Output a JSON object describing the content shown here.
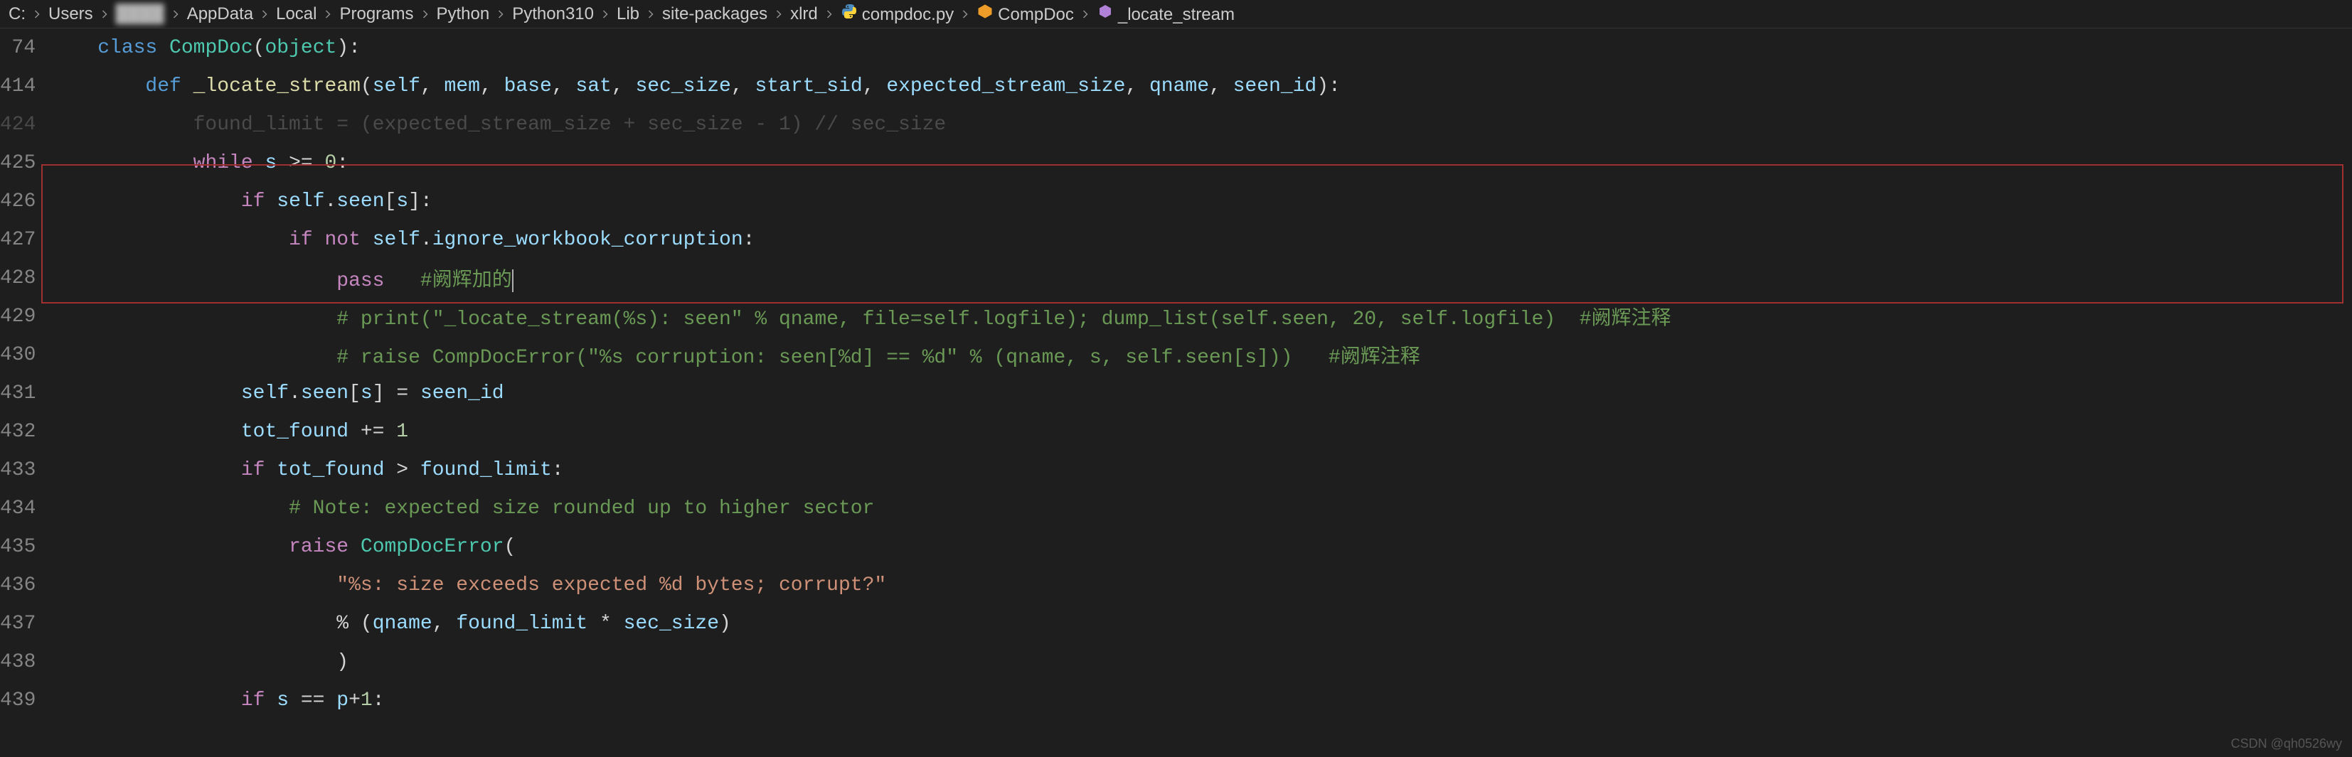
{
  "breadcrumb": {
    "items": [
      {
        "label": "C:",
        "icon": null
      },
      {
        "label": "Users",
        "icon": null
      },
      {
        "label": "████",
        "icon": null,
        "blurred": true
      },
      {
        "label": "AppData",
        "icon": null
      },
      {
        "label": "Local",
        "icon": null
      },
      {
        "label": "Programs",
        "icon": null
      },
      {
        "label": "Python",
        "icon": null
      },
      {
        "label": "Python310",
        "icon": null
      },
      {
        "label": "Lib",
        "icon": null
      },
      {
        "label": "site-packages",
        "icon": null
      },
      {
        "label": "xlrd",
        "icon": null
      },
      {
        "label": "compdoc.py",
        "icon": "python"
      },
      {
        "label": "CompDoc",
        "icon": "class"
      },
      {
        "label": "_locate_stream",
        "icon": "method"
      }
    ]
  },
  "lines": [
    {
      "num": "74",
      "kind": "sticky",
      "tokens": [
        {
          "t": "    ",
          "c": ""
        },
        {
          "t": "class",
          "c": "kw-class"
        },
        {
          "t": " ",
          "c": ""
        },
        {
          "t": "CompDoc",
          "c": "class-name"
        },
        {
          "t": "(",
          "c": "punct"
        },
        {
          "t": "object",
          "c": "builtin"
        },
        {
          "t": "):",
          "c": "punct"
        }
      ]
    },
    {
      "num": "414",
      "kind": "sticky",
      "tokens": [
        {
          "t": "        ",
          "c": ""
        },
        {
          "t": "def",
          "c": "kw-def"
        },
        {
          "t": " ",
          "c": ""
        },
        {
          "t": "_locate_stream",
          "c": "func-name"
        },
        {
          "t": "(",
          "c": "punct"
        },
        {
          "t": "self",
          "c": "param"
        },
        {
          "t": ", ",
          "c": "punct"
        },
        {
          "t": "mem",
          "c": "param"
        },
        {
          "t": ", ",
          "c": "punct"
        },
        {
          "t": "base",
          "c": "param"
        },
        {
          "t": ", ",
          "c": "punct"
        },
        {
          "t": "sat",
          "c": "param"
        },
        {
          "t": ", ",
          "c": "punct"
        },
        {
          "t": "sec_size",
          "c": "param"
        },
        {
          "t": ", ",
          "c": "punct"
        },
        {
          "t": "start_sid",
          "c": "param"
        },
        {
          "t": ", ",
          "c": "punct"
        },
        {
          "t": "expected_stream_size",
          "c": "param"
        },
        {
          "t": ", ",
          "c": "punct"
        },
        {
          "t": "qname",
          "c": "param"
        },
        {
          "t": ", ",
          "c": "punct"
        },
        {
          "t": "seen_id",
          "c": "param"
        },
        {
          "t": "):",
          "c": "punct"
        }
      ]
    },
    {
      "num": "424",
      "kind": "faded",
      "tokens": [
        {
          "t": "            found_limit = (expected_stream_size + sec_size - 1) // sec_size",
          "c": "faded"
        }
      ]
    },
    {
      "num": "425",
      "kind": "normal",
      "tokens": [
        {
          "t": "            ",
          "c": ""
        },
        {
          "t": "while",
          "c": "kw-control"
        },
        {
          "t": " ",
          "c": ""
        },
        {
          "t": "s",
          "c": "prop"
        },
        {
          "t": " >= ",
          "c": "operator"
        },
        {
          "t": "0",
          "c": "number"
        },
        {
          "t": ":",
          "c": "punct"
        }
      ]
    },
    {
      "num": "426",
      "kind": "normal",
      "tokens": [
        {
          "t": "                ",
          "c": ""
        },
        {
          "t": "if",
          "c": "kw-control"
        },
        {
          "t": " ",
          "c": ""
        },
        {
          "t": "self",
          "c": "self-ref"
        },
        {
          "t": ".",
          "c": "punct"
        },
        {
          "t": "seen",
          "c": "prop"
        },
        {
          "t": "[",
          "c": "punct"
        },
        {
          "t": "s",
          "c": "prop"
        },
        {
          "t": "]:",
          "c": "punct"
        }
      ]
    },
    {
      "num": "427",
      "kind": "normal",
      "tokens": [
        {
          "t": "                    ",
          "c": ""
        },
        {
          "t": "if",
          "c": "kw-control"
        },
        {
          "t": " ",
          "c": ""
        },
        {
          "t": "not",
          "c": "kw-control"
        },
        {
          "t": " ",
          "c": ""
        },
        {
          "t": "self",
          "c": "self-ref"
        },
        {
          "t": ".",
          "c": "punct"
        },
        {
          "t": "ignore_workbook_corruption",
          "c": "prop"
        },
        {
          "t": ":",
          "c": "punct"
        }
      ]
    },
    {
      "num": "428",
      "kind": "normal",
      "tokens": [
        {
          "t": "                        ",
          "c": ""
        },
        {
          "t": "pass",
          "c": "kw-control"
        },
        {
          "t": "   ",
          "c": ""
        },
        {
          "t": "#阙辉加的",
          "c": "comment"
        },
        {
          "t": "",
          "c": "cursor"
        }
      ]
    },
    {
      "num": "429",
      "kind": "normal",
      "tokens": [
        {
          "t": "                        ",
          "c": ""
        },
        {
          "t": "# print(\"_locate_stream(%s): seen\" % qname, file=self.logfile); dump_list(self.seen, 20, self.logfile)  #阙辉注释",
          "c": "comment"
        }
      ]
    },
    {
      "num": "430",
      "kind": "normal",
      "tokens": [
        {
          "t": "                        ",
          "c": ""
        },
        {
          "t": "# raise CompDocError(\"%s corruption: seen[%d] == %d\" % (qname, s, self.seen[s]))   #阙辉注释",
          "c": "comment"
        }
      ]
    },
    {
      "num": "431",
      "kind": "normal",
      "tokens": [
        {
          "t": "                ",
          "c": ""
        },
        {
          "t": "self",
          "c": "self-ref"
        },
        {
          "t": ".",
          "c": "punct"
        },
        {
          "t": "seen",
          "c": "prop"
        },
        {
          "t": "[",
          "c": "punct"
        },
        {
          "t": "s",
          "c": "prop"
        },
        {
          "t": "] = ",
          "c": "operator"
        },
        {
          "t": "seen_id",
          "c": "prop"
        }
      ]
    },
    {
      "num": "432",
      "kind": "normal",
      "tokens": [
        {
          "t": "                ",
          "c": ""
        },
        {
          "t": "tot_found",
          "c": "prop"
        },
        {
          "t": " += ",
          "c": "operator"
        },
        {
          "t": "1",
          "c": "number"
        }
      ]
    },
    {
      "num": "433",
      "kind": "normal",
      "tokens": [
        {
          "t": "                ",
          "c": ""
        },
        {
          "t": "if",
          "c": "kw-control"
        },
        {
          "t": " ",
          "c": ""
        },
        {
          "t": "tot_found",
          "c": "prop"
        },
        {
          "t": " > ",
          "c": "operator"
        },
        {
          "t": "found_limit",
          "c": "prop"
        },
        {
          "t": ":",
          "c": "punct"
        }
      ]
    },
    {
      "num": "434",
      "kind": "normal",
      "tokens": [
        {
          "t": "                    ",
          "c": ""
        },
        {
          "t": "# Note: expected size rounded up to higher sector",
          "c": "comment"
        }
      ]
    },
    {
      "num": "435",
      "kind": "normal",
      "tokens": [
        {
          "t": "                    ",
          "c": ""
        },
        {
          "t": "raise",
          "c": "kw-control"
        },
        {
          "t": " ",
          "c": ""
        },
        {
          "t": "CompDocError",
          "c": "class-name"
        },
        {
          "t": "(",
          "c": "punct"
        }
      ]
    },
    {
      "num": "436",
      "kind": "normal",
      "tokens": [
        {
          "t": "                        ",
          "c": ""
        },
        {
          "t": "\"%s: size exceeds expected %d bytes; corrupt?\"",
          "c": "string"
        }
      ]
    },
    {
      "num": "437",
      "kind": "normal",
      "tokens": [
        {
          "t": "                        % (",
          "c": "operator"
        },
        {
          "t": "qname",
          "c": "prop"
        },
        {
          "t": ", ",
          "c": "punct"
        },
        {
          "t": "found_limit",
          "c": "prop"
        },
        {
          "t": " * ",
          "c": "operator"
        },
        {
          "t": "sec_size",
          "c": "prop"
        },
        {
          "t": ")",
          "c": "punct"
        }
      ]
    },
    {
      "num": "438",
      "kind": "normal",
      "tokens": [
        {
          "t": "                        )",
          "c": "punct"
        }
      ]
    },
    {
      "num": "439",
      "kind": "normal",
      "tokens": [
        {
          "t": "                ",
          "c": ""
        },
        {
          "t": "if",
          "c": "kw-control"
        },
        {
          "t": " ",
          "c": ""
        },
        {
          "t": "s",
          "c": "prop"
        },
        {
          "t": " == ",
          "c": "operator"
        },
        {
          "t": "p",
          "c": "prop"
        },
        {
          "t": "+",
          "c": "operator"
        },
        {
          "t": "1",
          "c": "number"
        },
        {
          "t": ":",
          "c": "punct"
        }
      ]
    }
  ],
  "watermark": "CSDN @qh0526wy"
}
